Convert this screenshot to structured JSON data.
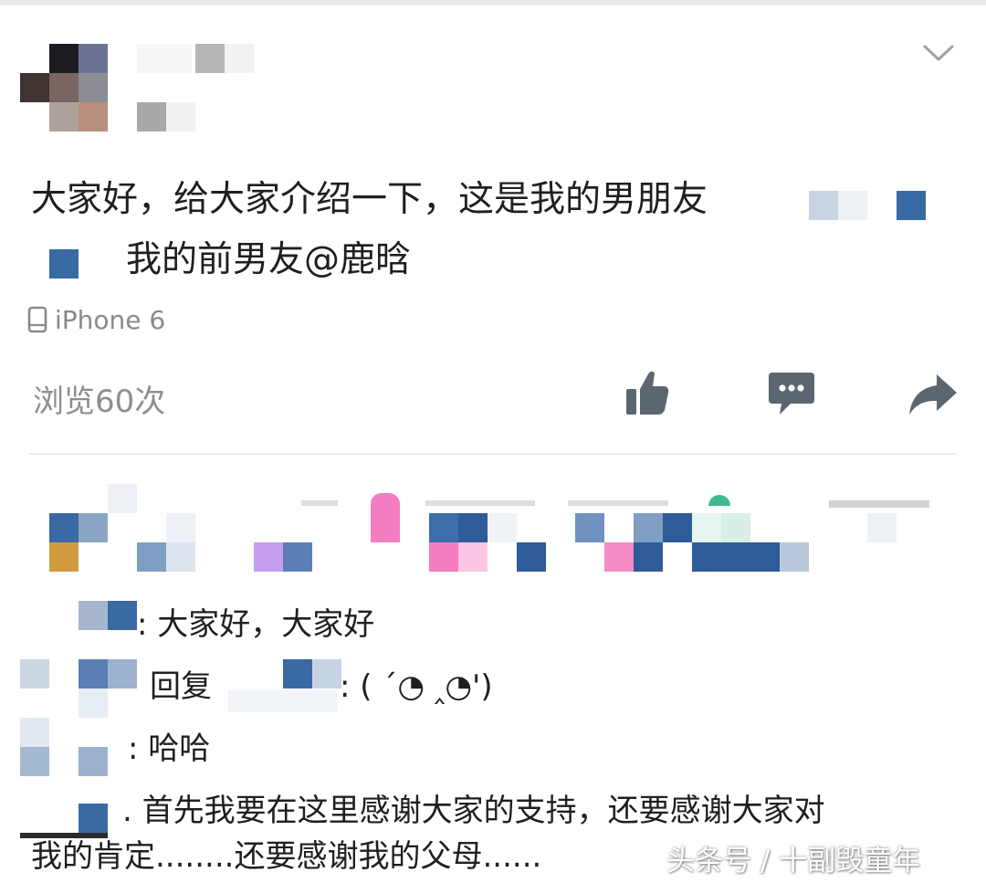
{
  "post": {
    "text_line1": "大家好，给大家介绍一下，这是我的男朋友",
    "text_line2": "我的前男友@鹿晗",
    "device": "iPhone 6",
    "views": "浏览60次"
  },
  "icons": {
    "more": "chevron-down-icon",
    "device": "phone-icon",
    "like": "thumbs-up-icon",
    "comment": "comment-icon",
    "share": "share-icon"
  },
  "comments": [
    {
      "text": ": 大家好，大家好"
    },
    {
      "text": "回复",
      "emoticon": ": ( ˊ◔ ‸◔')"
    },
    {
      "text": ": 哈哈"
    },
    {
      "text_line1": ". 首先我要在这里感谢大家的支持，还要感谢大家对",
      "text_line2": "我的肯定........还要感谢我的父母......"
    }
  ],
  "watermark": "头条号 / 十副毁童年",
  "colors": {
    "text": "#1f1f1f",
    "muted": "#8a8a8a",
    "icon": "#5c6670",
    "blur_blue": "#3a6aa3"
  }
}
